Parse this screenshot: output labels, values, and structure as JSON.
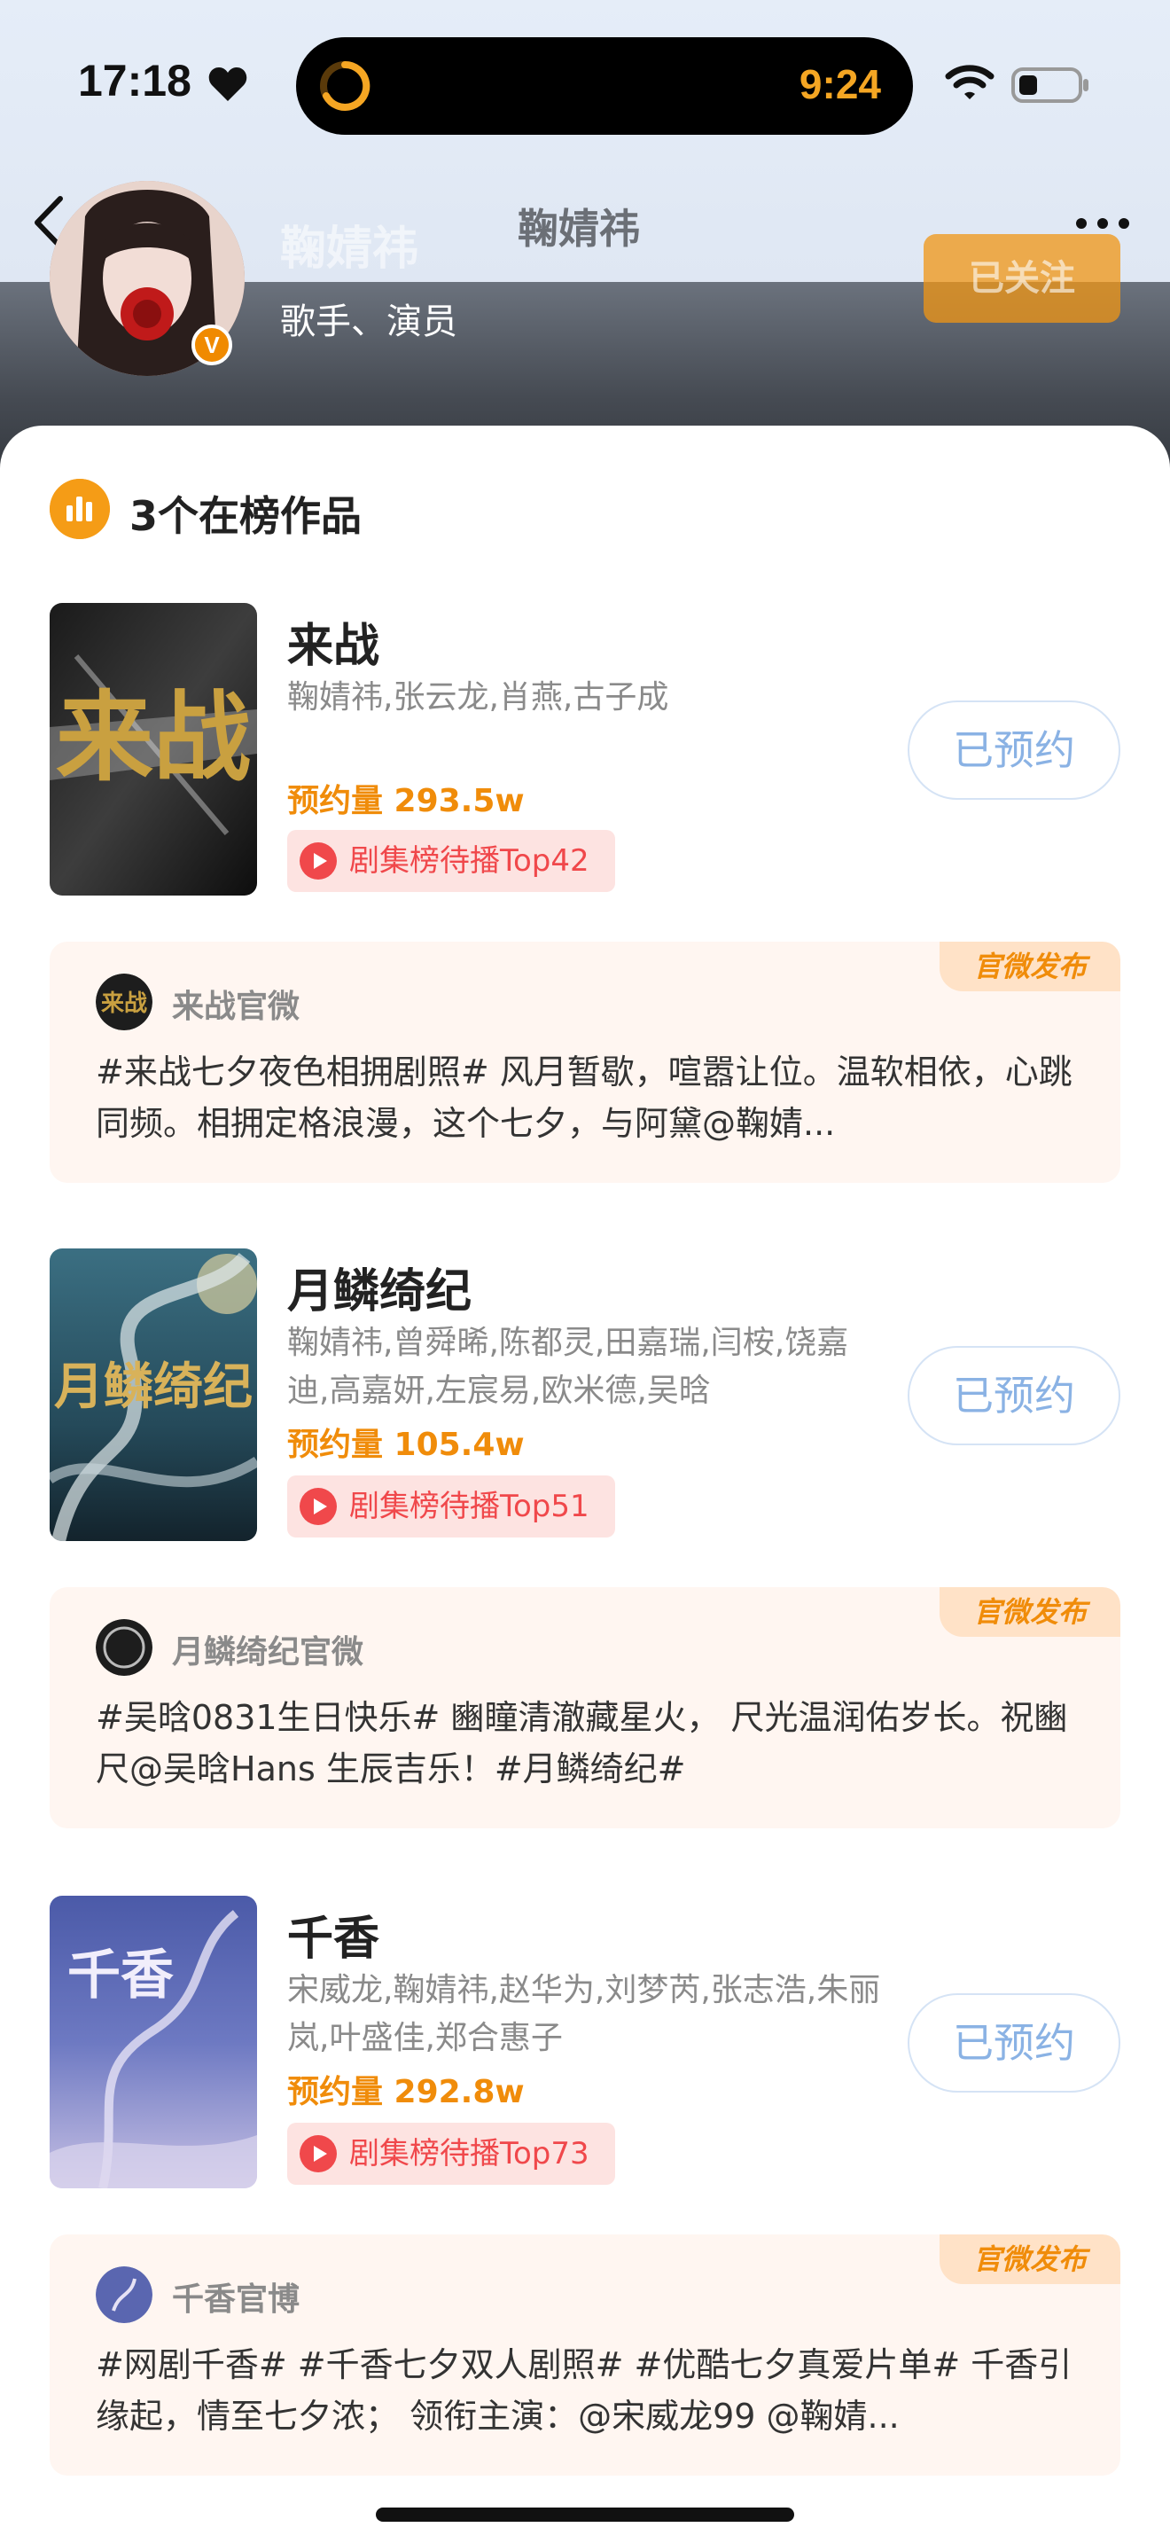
{
  "status_bar": {
    "time": "17:18",
    "island_time": "9:24"
  },
  "header": {
    "artist_name": "鞠婧祎",
    "nav_title": "鞠婧祎",
    "role": "歌手、演员",
    "verified_mark": "V",
    "follow_label": "已关注"
  },
  "section": {
    "title": "3个在榜作品"
  },
  "works": [
    {
      "title": "来战",
      "poster_text": "来战",
      "cast": "鞠婧祎,张云龙,肖燕,古子成",
      "reserve": "预约量 293.5w",
      "rank": "剧集榜待播Top42",
      "button": "已预约",
      "post": {
        "badge": "官微发布",
        "account": "来战官微",
        "text": "#来战七夕夜色相拥剧照# 风月暂歇，喧嚣让位。温软相依，心跳同频。相拥定格浪漫，这个七夕，与阿黛@鞠婧..."
      }
    },
    {
      "title": "月鳞绮纪",
      "poster_text": "月鳞绮纪",
      "cast": "鞠婧祎,曾舜晞,陈都灵,田嘉瑞,闫桉,饶嘉迪,高嘉妍,左宸易,欧米德,吴晗",
      "reserve": "预约量 105.4w",
      "rank": "剧集榜待播Top51",
      "button": "已预约",
      "post": {
        "badge": "官微发布",
        "account": "月鳞绮纪官微",
        "text": "#吴晗0831生日快乐# 豳瞳清澈藏星火， 尺光温润佑岁长。祝豳尺@吴晗Hans 生辰吉乐！#月鳞绮纪#"
      }
    },
    {
      "title": "千香",
      "poster_text": "千香",
      "cast": "宋威龙,鞠婧祎,赵华为,刘梦芮,张志浩,朱丽岚,叶盛佳,郑合惠子",
      "reserve": "预约量 292.8w",
      "rank": "剧集榜待播Top73",
      "button": "已预约",
      "post": {
        "badge": "官微发布",
        "account": "千香官博",
        "text": "#网剧千香# #千香七夕双人剧照# #优酷七夕真爱片单# 千香引缘起，情至七夕浓； 领衔主演：@宋威龙99 @鞠婧..."
      }
    }
  ],
  "colors": {
    "accent_orange": "#f08c0a",
    "rank_red": "#f0484b",
    "reserved_blue": "#8ab2e4"
  },
  "icons": [
    "heart-icon",
    "wifi-icon",
    "battery-icon",
    "back-icon",
    "more-icon",
    "chart-icon",
    "play-icon"
  ]
}
